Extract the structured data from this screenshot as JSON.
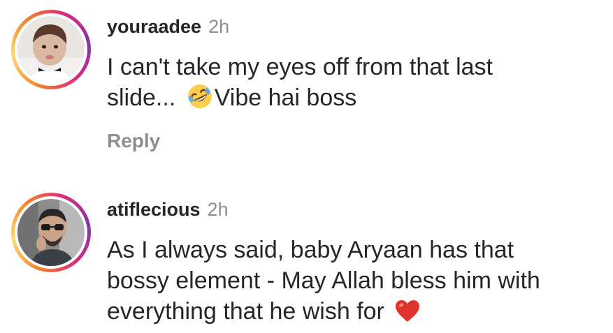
{
  "comments": [
    {
      "username": "youraadee",
      "time": "2h",
      "text_line1": "I can't take my eyes off from that last",
      "text_line2_before_emoji": "slide... ",
      "emoji": "rolling-on-floor-laughing-emoji",
      "text_line2_after_emoji": "Vibe hai boss",
      "reply_label": "Reply"
    },
    {
      "username": "atiflecious",
      "time": "2h",
      "text_line1": "As I always said, baby Aryaan has that",
      "text_line2": "bossy element - May Allah bless him with",
      "text_line3_before_emoji": "everything that he wish for ",
      "emoji": "red-heart-emoji"
    }
  ],
  "colors": {
    "text": "#262626",
    "muted": "#8e8e8e",
    "ring_start": "#f58529",
    "ring_end": "#dd2a7b"
  }
}
